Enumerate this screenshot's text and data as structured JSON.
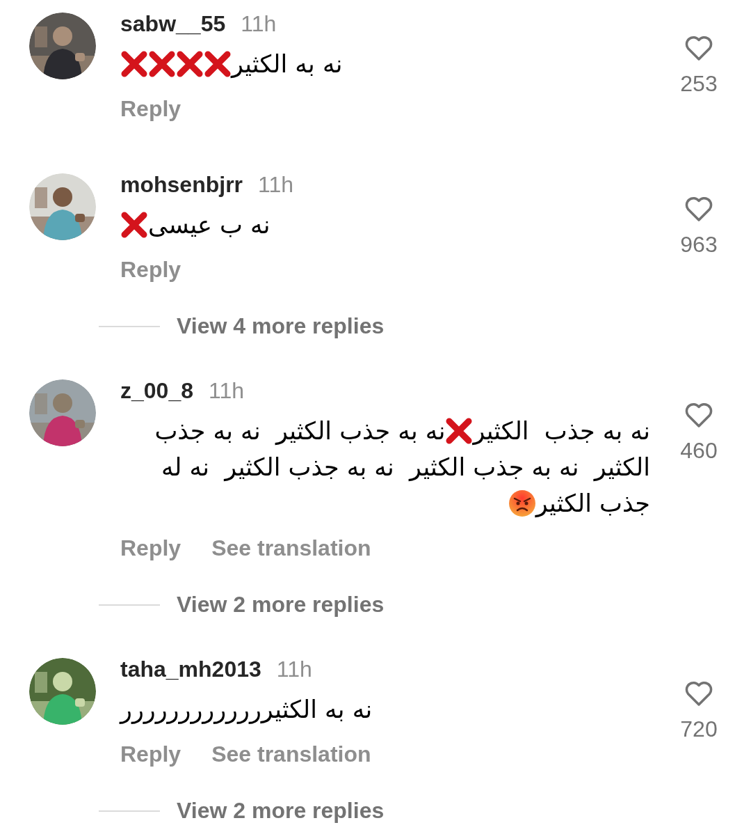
{
  "comments": [
    {
      "username": "sabw__55",
      "time": "11h",
      "avatar": {
        "kind": "picture"
      },
      "body": [
        {
          "kind": "text",
          "text": "نه به الکثیر"
        },
        {
          "kind": "cross"
        },
        {
          "kind": "cross"
        },
        {
          "kind": "cross"
        },
        {
          "kind": "cross"
        }
      ],
      "actions": [
        "Reply"
      ],
      "likes": "253"
    },
    {
      "username": "mohsenbjrr",
      "time": "11h",
      "avatar": {
        "kind": "picture"
      },
      "body": [
        {
          "kind": "text",
          "text": "نه ب عیسی"
        },
        {
          "kind": "cross"
        }
      ],
      "actions": [
        "Reply"
      ],
      "likes": "963",
      "more_replies": "View 4 more replies"
    },
    {
      "username": "z_00_8",
      "time": "11h",
      "avatar": {
        "kind": "picture"
      },
      "body": [
        {
          "kind": "text",
          "text": "نه به جذب  الکثیر"
        },
        {
          "kind": "cross"
        },
        {
          "kind": "text",
          "text": "نه به جذب الکثیر  نه به جذب الکثیر  نه به جذب الکثیر  نه به جذب الکثیر  نه له جذب الکثیر"
        },
        {
          "kind": "angry"
        }
      ],
      "actions": [
        "Reply",
        "See translation"
      ],
      "likes": "460",
      "more_replies": "View 2 more replies"
    },
    {
      "username": "taha_mh2013",
      "time": "11h",
      "avatar": {
        "kind": "picture"
      },
      "body": [
        {
          "kind": "text",
          "text": "نه به الکثیررررررررررررر"
        }
      ],
      "actions": [
        "Reply",
        "See translation"
      ],
      "likes": "720",
      "more_replies": "View 2 more replies"
    }
  ]
}
